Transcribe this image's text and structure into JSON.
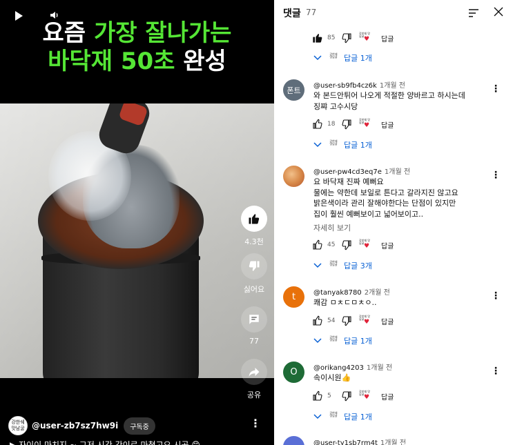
{
  "video": {
    "headline_line1_white": "요즘 ",
    "headline_line1_green": "가장 잘나가는",
    "headline_line2_green": "바닥재 50초",
    "headline_line2_white": " 완성",
    "like_count": "4.3천",
    "dislike_label": "싫어요",
    "comment_count": "77",
    "share_label": "공유",
    "channel_avatar_text": "강한쉐\n맛남굴",
    "channel_name": "@user-zb7sz7hw9i",
    "subscribe_label": "구독중",
    "caption": "▶ 자이이 마치지 ~ 그저 시간 간이로 마쳤고요 시공 😊"
  },
  "panel": {
    "title": "댓글",
    "count": "77"
  },
  "comments": [
    {
      "likes": "85",
      "reply_label": "답글",
      "replies_label": "답글 1개"
    },
    {
      "avatar_text": "폰트",
      "author": "@user-sb9fb4cz6k",
      "time": "1개월 전",
      "line1": "와 본드안튀어 나오게 적절한 양바르고 하시는데",
      "line2": "징쨔 고수시당",
      "likes": "18",
      "reply_label": "답글",
      "replies_label": "답글 1개"
    },
    {
      "author": "@user-pw4cd3eq7e",
      "time": "1개월 전",
      "line1": "요 바닥재 진짜 예뻐요",
      "line2": "물에는 약한데 보일로 튼다고 갈라지진 않고요",
      "line3": "밝은색이라 관리 잘해야한다는 단점이 있지만",
      "line4": "집이 훨씬 예뻐보이고 넓어보이고..",
      "read_more": "자세히 보기",
      "likes": "45",
      "reply_label": "답글",
      "replies_label": "답글 3개"
    },
    {
      "avatar_text": "t",
      "author": "@tanyak8780",
      "time": "2개월 전",
      "line1": "쾌감 ㅁㅊㄷㅁㅊㅇ..",
      "likes": "54",
      "reply_label": "답글",
      "replies_label": "답글 1개"
    },
    {
      "avatar_text": "O",
      "author": "@orikang4203",
      "time": "1개월 전",
      "line1": "속이시원👍",
      "likes": "5",
      "reply_label": "답글",
      "replies_label": "답글 1개"
    },
    {
      "author": "@user-ty1sb7rm4t",
      "time": "1개월 전"
    }
  ],
  "creator_badge_text": "강한쉐 맛남굴",
  "colors": {
    "headline_green": "#55e635",
    "link_blue": "#065fd4",
    "heart_red": "#e0243a",
    "avatar_font": "#5f6d7a",
    "avatar_t": "#e8710a",
    "avatar_o": "#1e6b36",
    "avatar_blue": "#5a6fd6"
  },
  "icons": [
    "play-icon",
    "volume-icon",
    "thumb-up-icon",
    "thumb-down-icon",
    "comment-icon",
    "share-icon",
    "more-vert-icon",
    "sort-icon",
    "close-icon",
    "chevron-down-icon",
    "heart-icon"
  ]
}
